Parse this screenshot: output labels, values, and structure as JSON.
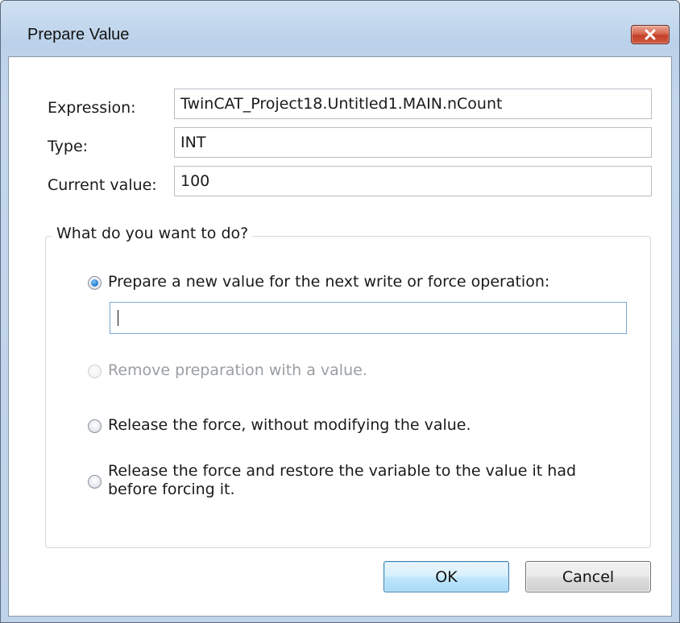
{
  "window": {
    "title": "Prepare Value",
    "close_icon": "close-x-icon"
  },
  "fields": {
    "expression": {
      "label": "Expression:",
      "value": "TwinCAT_Project18.Untitled1.MAIN.nCount"
    },
    "type": {
      "label": "Type:",
      "value": "INT"
    },
    "current_value": {
      "label": "Current value:",
      "value": "100"
    }
  },
  "group": {
    "legend": "What do you want to do?",
    "options": [
      {
        "label": "Prepare a new value for the next write or force operation:",
        "selected": true,
        "enabled": true
      },
      {
        "label": "Remove preparation with a value.",
        "selected": false,
        "enabled": false
      },
      {
        "label": "Release the force, without modifying the value.",
        "selected": false,
        "enabled": true
      },
      {
        "label": "Release the force and restore the variable to the value it had before forcing it.",
        "selected": false,
        "enabled": true
      }
    ],
    "new_value": {
      "value": "",
      "placeholder": ""
    }
  },
  "buttons": {
    "ok": "OK",
    "cancel": "Cancel"
  },
  "colors": {
    "accent": "#2a7fd1",
    "close_button": "#c2412b",
    "title_bar": "#bcd2ea"
  }
}
